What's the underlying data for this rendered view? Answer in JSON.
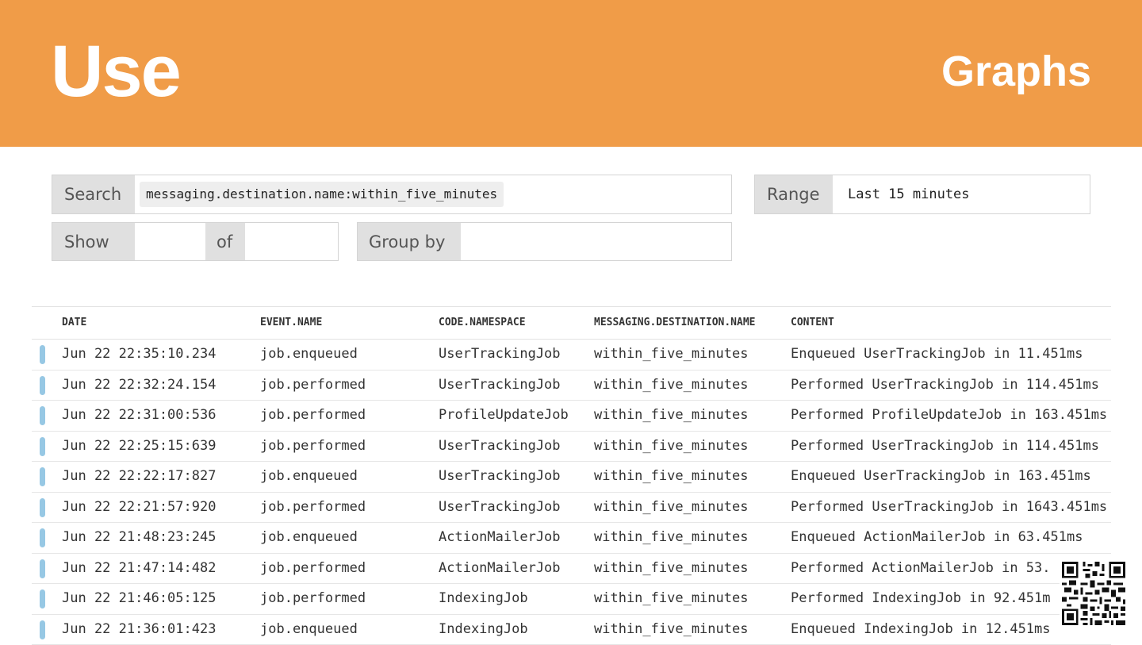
{
  "header": {
    "title": "Use",
    "right": "Graphs"
  },
  "search": {
    "label": "Search",
    "query": "messaging.destination.name:within_five_minutes"
  },
  "range": {
    "label": "Range",
    "value": "Last 15 minutes"
  },
  "show": {
    "label": "Show",
    "of_label": "of",
    "value": "",
    "of_value": ""
  },
  "group_by": {
    "label": "Group by",
    "value": ""
  },
  "table": {
    "columns": [
      "DATE",
      "EVENT.NAME",
      "CODE.NAMESPACE",
      "MESSAGING.DESTINATION.NAME",
      "CONTENT"
    ],
    "rows": [
      [
        "Jun 22 22:35:10.234",
        "job.enqueued",
        "UserTrackingJob",
        "within_five_minutes",
        "Enqueued UserTrackingJob in 11.451ms"
      ],
      [
        "Jun 22 22:32:24.154",
        "job.performed",
        "UserTrackingJob",
        "within_five_minutes",
        "Performed UserTrackingJob in 114.451ms"
      ],
      [
        "Jun 22 22:31:00:536",
        "job.performed",
        "ProfileUpdateJob",
        "within_five_minutes",
        "Performed ProfileUpdateJob in 163.451ms"
      ],
      [
        "Jun 22 22:25:15:639",
        "job.performed",
        "UserTrackingJob",
        "within_five_minutes",
        "Performed UserTrackingJob in 114.451ms"
      ],
      [
        "Jun 22 22:22:17:827",
        "job.enqueued",
        "UserTrackingJob",
        "within_five_minutes",
        "Enqueued UserTrackingJob in 163.451ms"
      ],
      [
        "Jun 22 22:21:57:920",
        "job.performed",
        "UserTrackingJob",
        "within_five_minutes",
        "Performed UserTrackingJob in 1643.451ms"
      ],
      [
        "Jun 22 21:48:23:245",
        "job.enqueued",
        "ActionMailerJob",
        "within_five_minutes",
        "Enqueued ActionMailerJob in 63.451ms"
      ],
      [
        "Jun 22 21:47:14:482",
        "job.performed",
        "ActionMailerJob",
        "within_five_minutes",
        "Performed ActionMailerJob in 53."
      ],
      [
        "Jun 22 21:46:05:125",
        "job.performed",
        "IndexingJob",
        "within_five_minutes",
        "Performed IndexingJob in 92.451m"
      ],
      [
        "Jun 22 21:36:01:423",
        "job.enqueued",
        "IndexingJob",
        "within_five_minutes",
        "Enqueued IndexingJob in 12.451ms"
      ]
    ]
  },
  "colors": {
    "header_bg": "#F09C48",
    "row_marker": "#97C8E4"
  },
  "icons": {
    "qr": "qr-code-icon"
  }
}
